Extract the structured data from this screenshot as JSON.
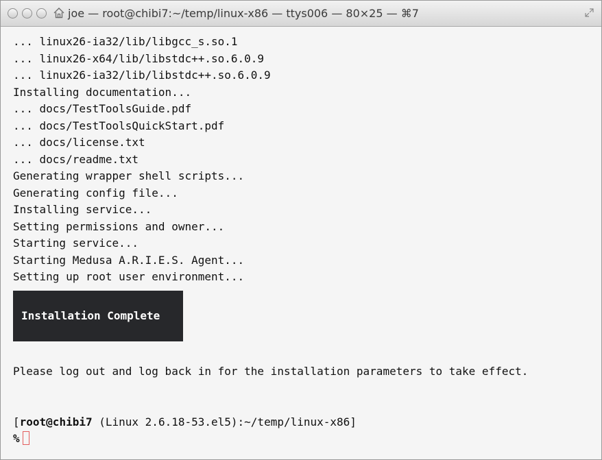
{
  "window": {
    "title": "joe — root@chibi7:~/temp/linux-x86 — ttys006 — 80×25 — ⌘7"
  },
  "terminal": {
    "lines": [
      "... linux26-ia32/lib/libgcc_s.so.1",
      "... linux26-x64/lib/libstdc++.so.6.0.9",
      "... linux26-ia32/lib/libstdc++.so.6.0.9",
      "Installing documentation...",
      "... docs/TestToolsGuide.pdf",
      "... docs/TestToolsQuickStart.pdf",
      "... docs/license.txt",
      "... docs/readme.txt",
      "Generating wrapper shell scripts...",
      "Generating config file...",
      "Installing service...",
      "Setting permissions and owner...",
      "Starting service...",
      "Starting Medusa A.R.I.E.S. Agent...",
      "Setting up root user environment..."
    ],
    "banner": "Installation Complete",
    "message": "Please log out and log back in for the installation parameters to take effect.",
    "prompt_open": "[",
    "prompt_user": "root@chibi7",
    "prompt_rest": " (Linux 2.6.18-53.el5):~/temp/linux-x86]",
    "prompt_symbol": "%"
  },
  "colors": {
    "banner_bg": "#27282b",
    "cursor": "#e35d5d"
  },
  "icons": {
    "traffic": [
      "close-button",
      "minimize-button",
      "zoom-button"
    ],
    "title": "home-icon",
    "corner": "fullscreen-icon"
  }
}
